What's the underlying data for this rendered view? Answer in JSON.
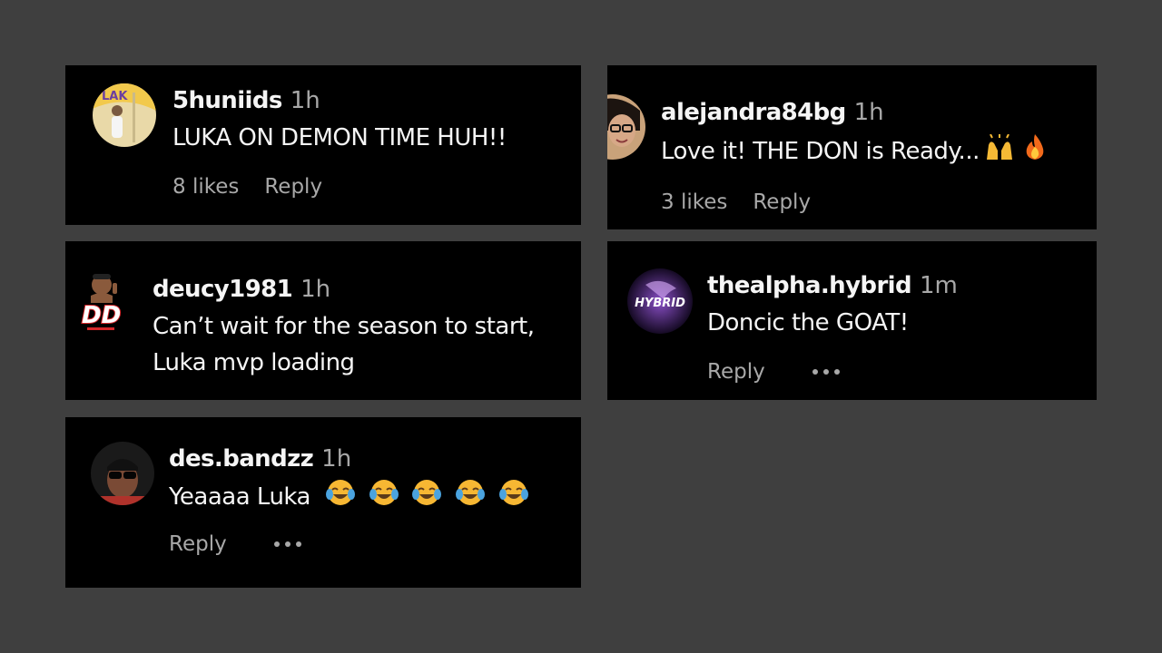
{
  "comments": [
    {
      "username": "5huniids",
      "time": "1h",
      "text": "LUKA ON DEMON TIME HUH!!",
      "likes": "8 likes",
      "reply": "Reply"
    },
    {
      "username": "deucy1981",
      "time": "1h",
      "text_line1": "Can’t wait for the season to start,",
      "text_line2": "Luka mvp loading"
    },
    {
      "username": "des.bandzz",
      "time": "1h",
      "text": "Yeaaaa Luka",
      "emojis": [
        "tears-of-joy",
        "tears-of-joy",
        "tears-of-joy",
        "tears-of-joy",
        "tears-of-joy"
      ],
      "reply": "Reply",
      "more": "more-options"
    },
    {
      "username": "alejandra84bg",
      "time": "1h",
      "text": "Love it! THE DON is Ready...",
      "emojis": [
        "raising-hands",
        "fire"
      ],
      "likes": "3 likes",
      "reply": "Reply"
    },
    {
      "username": "thealpha.hybrid",
      "time": "1m",
      "text": "Doncic the GOAT!",
      "reply": "Reply",
      "more": "more-options"
    }
  ],
  "avatar_text": {
    "deucy": "DD",
    "hybrid": "HYBRID"
  },
  "colors": {
    "background": "#3f3f3f",
    "card": "#000000",
    "primary_text": "#f5f5f5",
    "secondary_text": "#a8a8a8"
  }
}
